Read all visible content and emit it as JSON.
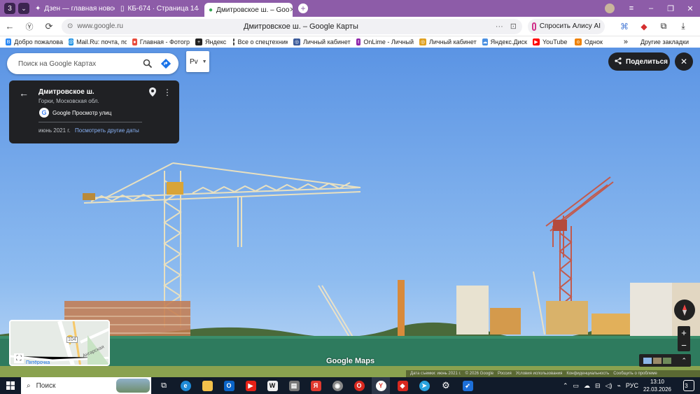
{
  "browser": {
    "tab_count": "3",
    "tabs": [
      {
        "label": "Дзен — главная новостна",
        "icon": "dzen-icon"
      },
      {
        "label": "КБ-674 · Страница 144 · C",
        "icon": "page-icon"
      },
      {
        "label": "Дмитровское ш. – Goo",
        "icon": "maps-pin-icon"
      }
    ],
    "address": "www.google.ru",
    "page_title": "Дмитровское ш. – Google Карты",
    "alice_label": "Спросить Алису AI",
    "window_controls": [
      "minimize-icon",
      "maximize-icon",
      "close-icon"
    ]
  },
  "bookmarks": [
    {
      "label": "Добро пожалова",
      "color": "#2787f5"
    },
    {
      "label": "Mail.Ru: почта, по",
      "color": "#168de2"
    },
    {
      "label": "Главная - Фотогр",
      "color": "#e84b3c"
    },
    {
      "label": "Яндекс",
      "color": "#222222"
    },
    {
      "label": "Все о спецтехник",
      "color": "#444444"
    },
    {
      "label": "Личный кабинет",
      "color": "#3a5a9a"
    },
    {
      "label": "OnLime - Личный",
      "color": "#8e24aa"
    },
    {
      "label": "Личный кабинет",
      "color": "#e0a020"
    },
    {
      "label": "Яндекс.Диск",
      "color": "#4a90e2"
    },
    {
      "label": "YouTube",
      "color": "#ff0000"
    },
    {
      "label": "Однок",
      "color": "#ee8208"
    }
  ],
  "bookmarks_more": "»",
  "bookmarks_other": "Другие закладки",
  "maps": {
    "search_placeholder": "Поиск на Google Картах",
    "lang_button": "Рv",
    "place_title": "Дмитровское ш.",
    "place_subtitle": "Горки, Московская обл.",
    "provider": "Google Просмотр улиц",
    "capture_date": "июнь 2021 г.",
    "other_dates_link": "Посмотреть другие даты",
    "share_label": "Поделиться",
    "logo": "Google Maps",
    "minimap_road_1": "104",
    "minimap_road_2": "Ангарская",
    "minimap_place": "Пятёрочка",
    "footer": [
      "Дата съемки: июнь 2021 г.",
      "© 2026 Google",
      "Россия",
      "Условия использования",
      "Конфиденциальность",
      "Сообщить о проблеме"
    ]
  },
  "taskbar": {
    "search_label": "Поиск",
    "lang": "РУС",
    "time": "13:10",
    "date": "22.03.2026",
    "notifications": "3"
  },
  "colors": {
    "tab_strip": "#8d5ca8",
    "sky": "#5f9be6",
    "fence": "#2e7b5e",
    "panel_dark": "#202124",
    "link_blue": "#8ab4f8"
  }
}
